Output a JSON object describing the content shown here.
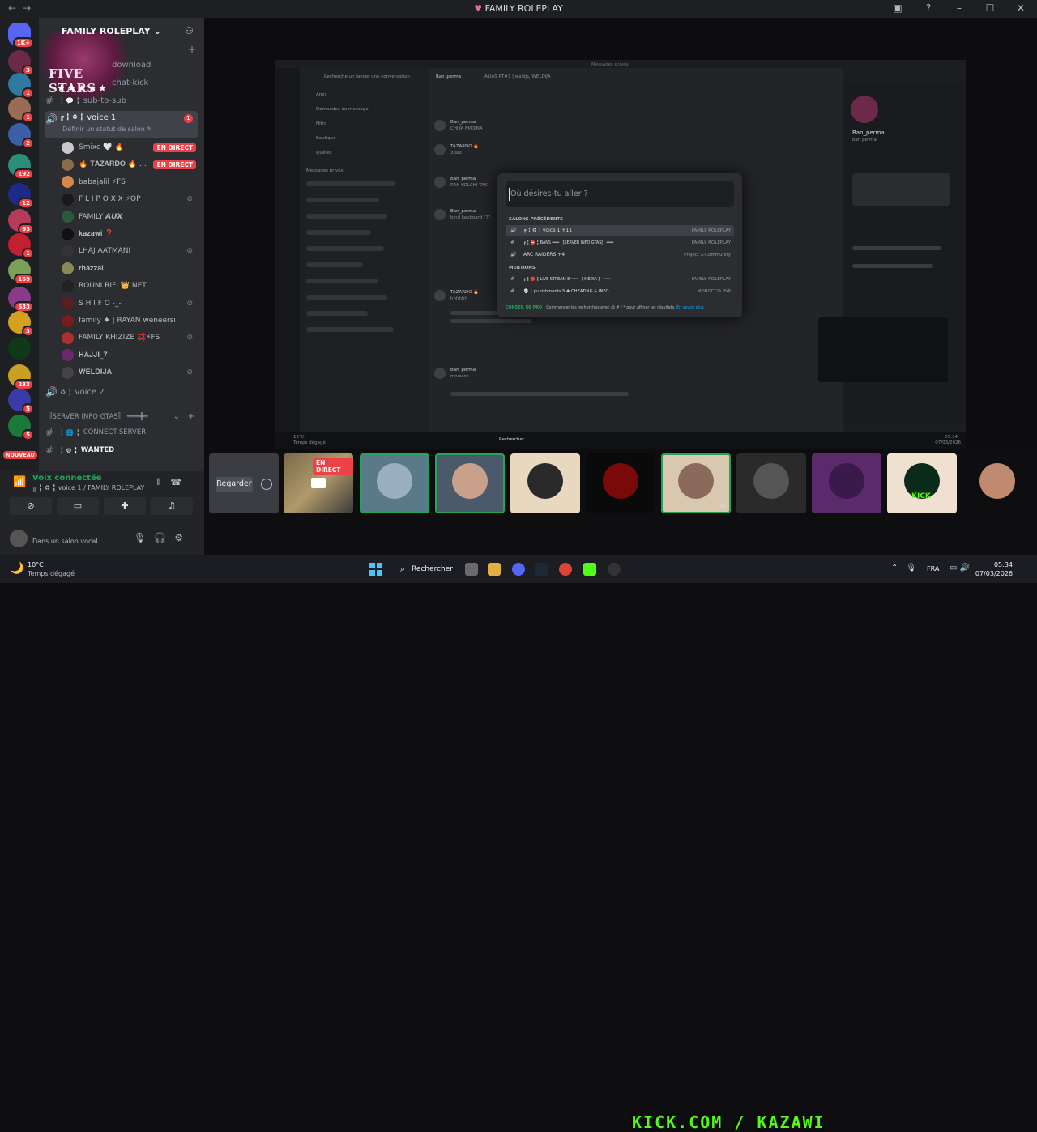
{
  "window": {
    "title": "FAMILY ROLEPLAY",
    "nav_back": "←",
    "nav_forward": "→",
    "controls": [
      "▣",
      "?",
      "–",
      "☐",
      "✕"
    ]
  },
  "server_rail": {
    "badges": [
      "1K+",
      "3",
      "1",
      "1",
      "2",
      "192",
      "12",
      "65",
      "1",
      "169",
      "633",
      "3",
      "233",
      "5",
      "5"
    ],
    "new_badge": "NOUVEAU"
  },
  "guild": {
    "name": "FAMILY ROLEPLAY",
    "banner_text": "FIVE STARS",
    "banner_stars": "★★★★★"
  },
  "channels": [
    {
      "prefix": "#",
      "label": "download"
    },
    {
      "prefix": "#",
      "label": "chat-kick"
    },
    {
      "prefix": "# ╏ 💬",
      "label": "sub-to-sub"
    }
  ],
  "active_channel": {
    "label": "voice 1",
    "prefix": "🔊 ╔ ╏ ♻ ╏",
    "subtitle": "Définir un statut de salon ✎",
    "unread": "1"
  },
  "voice_users": [
    {
      "name": "Smixe 🤍 🔥",
      "live": true,
      "color": "#c9c9c9"
    },
    {
      "name": "🔥 𝐓𝐀𝐙𝐀𝐑𝐃𝐎 🔥 …",
      "live": true,
      "color": "#8a6b4a"
    },
    {
      "name": "babajalil ⚡FS",
      "live": false,
      "color": "#d4884c"
    },
    {
      "name": "F L I P O X X ⚡OP",
      "live": false,
      "color": "#1a1a1a",
      "muted": true
    },
    {
      "name": "FAMILY 𝘼𝙐𝙓",
      "live": false,
      "color": "#2d5a3c"
    },
    {
      "name": "𝐤𝐚𝐳𝐚𝐰𝐢 ❓",
      "live": false,
      "color": "#111111"
    },
    {
      "name": "LHAJ AATMANI",
      "live": false,
      "color": "#333",
      "muted": true
    },
    {
      "name": "𝐫𝐡𝐚𝐳𝐳𝐚𝐥",
      "live": false,
      "color": "#8a8a55"
    },
    {
      "name": "ROUNI RIFI 👑.NET",
      "live": false,
      "color": "#222"
    },
    {
      "name": "S H I F O -_-",
      "live": false,
      "color": "#5a2020",
      "muted": true
    },
    {
      "name": "family ♠ | RAYAN weneersi",
      "live": false,
      "color": "#7a1c1c"
    },
    {
      "name": "FAMILY KHIZIZE 💢⚡FS",
      "live": false,
      "color": "#a83232",
      "muted": true
    },
    {
      "name": "𝐇𝐀𝐉𝐉𝐈_𝟕",
      "live": false,
      "color": "#6a2a6a"
    },
    {
      "name": "𝐖𝐄𝐋𝐃𝐈𝐉𝐀",
      "live": false,
      "color": "#444",
      "muted": true
    }
  ],
  "more_channels": [
    {
      "prefix": "🔊 ♻ ╏",
      "label": "voice 2"
    },
    {
      "prefix": "⫩═══",
      "label": "〚SERVER INFO GTAS〛 ═══╋═"
    },
    {
      "prefix": "# ╏ 🌐 ╏",
      "label": "CONNECT-SERVER"
    },
    {
      "prefix": "# ╏ ⚙ ╏",
      "label": "WANTED"
    }
  ],
  "voice_status": {
    "title": "Voix connectée",
    "subtitle": "╔ ╏ ♻ ╏ voice 1 / FAMILY ROLEPLAY",
    "user_status": "Dans un salon vocal"
  },
  "inner_app": {
    "title": "Messages privés",
    "dm_search": "Recherche un lancer une conversation",
    "chat_name": "Ban_perma",
    "tabs": "ALIAS   RT#3  |  waldjs, WELDIJA",
    "nav": [
      "Amis",
      "Demandes de message",
      "Nitro",
      "Boutique",
      "Quêtes"
    ],
    "section": "Messages privés",
    "messages": [
      {
        "name": "Ban_perma",
        "text": "CHIYA FMDINA"
      },
      {
        "name": "TAZARDO 🔥",
        "text": "3ba3"
      },
      {
        "name": "Ban_perma",
        "text": "RAH KOLCHI TAK"
      },
      {
        "name": "Ban_perma",
        "text": "bind keyboard \"7\""
      },
      {
        "name": "TAZARDO 🔥",
        "text": "hhhhhh"
      },
      {
        "name": "Ban_perma",
        "text": "mowent"
      }
    ],
    "profile_name": "Ban_perma",
    "profile_sub": "ban perma",
    "taskbar_weather": "12°C",
    "taskbar_weather_sub": "Temps dégagé",
    "taskbar_search": "Rechercher",
    "taskbar_time": "05:34",
    "taskbar_date": "07/03/2026"
  },
  "quick_switcher": {
    "placeholder": "Où désires-tu aller ?",
    "section_recent": "SALONS PRÉCÉDENTS",
    "section_mentions": "MENTIONS",
    "rows": [
      {
        "icon": "🔊",
        "label": "╔ ╏ ♻ ╏ voice 1  +11",
        "server": "FAMILY ROLEPLAY",
        "selected": true
      },
      {
        "icon": "#",
        "label": "╔ ╏ ⛔ ╏ BANS ═══ 〚SERVER INFO GTAS〛 ═══",
        "server": "FAMILY ROLEPLAY",
        "selected": false
      },
      {
        "icon": "🔊",
        "label": "ARC RAIDERS  +4",
        "server": "Project X-Community",
        "selected": false
      },
      {
        "icon": "#",
        "label": "╔ ╏ 🔴 ╏ LIVE-STREAM  8 ═══ 〚 MEDIA 〛 ═══",
        "server": "FAMILY ROLEPLAY",
        "selected": false
      },
      {
        "icon": "#",
        "label": "💀 ╏ punishments  5 ✚ CHEATING & INFO",
        "server": "MOROCCO PVP",
        "selected": false
      }
    ],
    "tip_label": "CONSEIL DE PRO :",
    "tip_text": "Commencer les recherches avec @ # ! * pour affiner les résultats.",
    "tip_link": "En savoir plus"
  },
  "stream_strip": {
    "watch_label": "Regarder",
    "live_label": "EN DIRECT",
    "kick_label": "KICK"
  },
  "taskbar": {
    "weather_temp": "10°C",
    "weather_desc": "Temps dégagé",
    "search": "Rechercher",
    "banner": "KICK.COM / KAZAWI",
    "lang": "FRA",
    "time": "05:34",
    "date": "07/03/2026"
  },
  "colors": {
    "accent_green": "#23a55a",
    "live_red": "#ed4245",
    "kick_green": "#53fc18",
    "link_blue": "#00a8fc"
  }
}
